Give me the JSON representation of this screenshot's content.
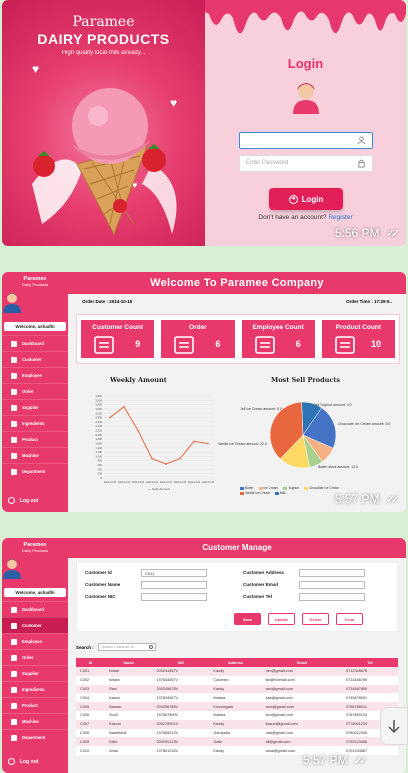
{
  "login": {
    "brand_line1": "Paramee",
    "brand_line2": "DAIRY PRODUCTS",
    "tagline": "High quality local milk already...",
    "title": "Login",
    "username_placeholder": "",
    "password_placeholder": "Enter Password",
    "button_label": "Login",
    "account_text": "Don't have an account?",
    "register_label": "Register",
    "time": "5:56 PM"
  },
  "colors": {
    "primary": "#e8396d",
    "primary_dark": "#c81d52",
    "login_panel": "#f7d0dc",
    "chat_bg": "#d9efd3"
  },
  "sidebar": {
    "brand": "Paramee",
    "brand_sub": "Dairy Products",
    "welcome": "Welcome, ashadhi",
    "items": [
      {
        "label": "Dashboard",
        "icon": "dashboard-icon"
      },
      {
        "label": "Customer",
        "icon": "customer-icon"
      },
      {
        "label": "Employee",
        "icon": "employee-icon"
      },
      {
        "label": "Order",
        "icon": "order-icon"
      },
      {
        "label": "Supplier",
        "icon": "supplier-icon"
      },
      {
        "label": "Ingredients",
        "icon": "ingredients-icon"
      },
      {
        "label": "Product",
        "icon": "product-icon"
      },
      {
        "label": "Machine",
        "icon": "machine-icon"
      },
      {
        "label": "Department",
        "icon": "department-icon"
      }
    ],
    "logout": "Log out"
  },
  "dashboard": {
    "title": "Welcome To Paramee Company",
    "order_date": "Order Date : 2024-10-10",
    "order_time": "Order Time : 17:29:5..",
    "cards": [
      {
        "label": "Customer Count",
        "value": "9",
        "icon": "group-icon"
      },
      {
        "label": "Order",
        "value": "6",
        "icon": "order-list-icon"
      },
      {
        "label": "Employee Count",
        "value": "6",
        "icon": "employees-icon"
      },
      {
        "label": "Product Count",
        "value": "10",
        "icon": "product-box-icon"
      }
    ],
    "time": "5:57 PM"
  },
  "customer": {
    "title": "Customer Manage",
    "labels": {
      "id": "Customer Id",
      "name": "Customer Name",
      "nic": "Customer NIC",
      "address": "Customer Address",
      "email": "Customer Email",
      "tel": "Customer Tel"
    },
    "id_value": "C011",
    "buttons": [
      "Save",
      "Update",
      "Delete",
      "Clear"
    ],
    "search_label": "Search :",
    "search_placeholder": "Search Customer Id",
    "columns": [
      "Id",
      "Name",
      "NIC",
      "Address",
      "Email",
      "Tel"
    ],
    "rows": [
      [
        "C001",
        "Nimal",
        "200234567V",
        "Kandy",
        "nim@gmail.com",
        "0712345678"
      ],
      [
        "C002",
        "Ishara",
        "197834567V",
        "Colombo",
        "ish@hotmail.com",
        "0723456789"
      ],
      [
        "C003",
        "Ravi",
        "200245678V",
        "Kandy",
        "ravi@gmail.com",
        "0734567890"
      ],
      [
        "C004",
        "Kasun",
        "197834567V",
        "Matara",
        "kas@gmail.com",
        "0745678901"
      ],
      [
        "C005",
        "Saman",
        "200256789V",
        "Kurunegala",
        "sam@gmail.com",
        "0756789012"
      ],
      [
        "C006",
        "Sunil",
        "197867890V",
        "Matara",
        "sun@gmail.com",
        "0767890123"
      ],
      [
        "C007",
        "Kasuni",
        "200278901V",
        "Kandy",
        "kasuni@gmail.com",
        "0778901234"
      ],
      [
        "C008",
        "Nadeesha",
        "197889012V",
        "Gampaha",
        "nad@gmail.com",
        "0789012345"
      ],
      [
        "C009",
        "Dilini",
        "200290123V",
        "Galle",
        "dil@gmail.com",
        "0790123456"
      ],
      [
        "C010",
        "Amal",
        "197801234V",
        "Kandy",
        "amal@gmail.com",
        "0701234567"
      ]
    ],
    "time": "5:57 PM"
  },
  "chart_data": [
    {
      "type": "line",
      "title": "Weekly Amount",
      "x": [
        "2024-10-03",
        "2024-10-04",
        "2024-10-05",
        "2024-10-06",
        "2024-10-07",
        "2024-10-08",
        "2024-10-09",
        "2024-10-10"
      ],
      "series": [
        {
          "name": "Daily Amount",
          "values": [
            2800,
            3300,
            2200,
            900,
            650,
            900,
            1700,
            1600
          ]
        }
      ],
      "ylim": [
        0,
        3800
      ],
      "yticks": [
        0,
        200,
        400,
        600,
        800,
        1000,
        1200,
        1400,
        1600,
        1800,
        2000,
        2200,
        2400,
        2600,
        2800,
        3000,
        3200,
        3400,
        3600,
        3800
      ],
      "grid": true,
      "legend": "bottom"
    },
    {
      "type": "pie",
      "title": "Most Sell Products",
      "categories": [
        "Butter",
        "Ice Cream",
        "Yoghurt",
        "Chocolate Ice Cream",
        "Vanilla Ice Cream",
        "Milk"
      ],
      "values": [
        13.0,
        5.0,
        4.0,
        9.0,
        22.0,
        6.0
      ],
      "colors": [
        "#4472c4",
        "#f4b183",
        "#a9d18e",
        "#ffd966",
        "#e8673f",
        "#2e75b6"
      ],
      "legend": "bottom"
    }
  ]
}
